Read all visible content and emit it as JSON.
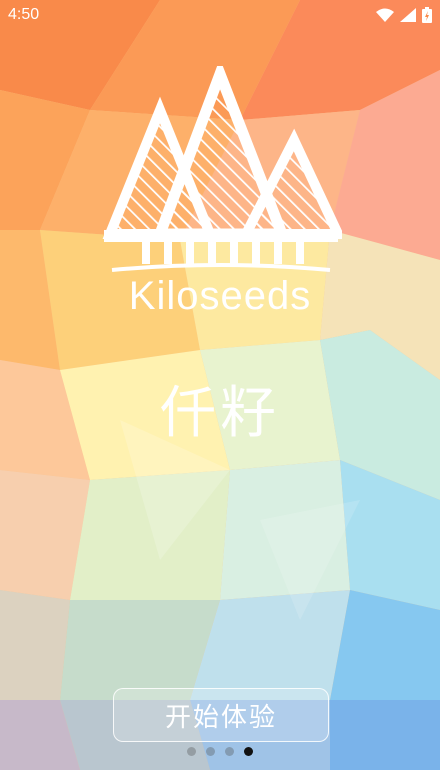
{
  "status_bar": {
    "time": "4:50",
    "icons": [
      "wifi-icon",
      "signal-icon",
      "battery-icon"
    ]
  },
  "brand": {
    "logo_icon": "mountains-logo-icon",
    "name": "Kiloseeds",
    "chinese_name": "仟籽"
  },
  "actions": {
    "start_label": "开始体验"
  },
  "pager": {
    "total": 4,
    "active_index": 3
  }
}
